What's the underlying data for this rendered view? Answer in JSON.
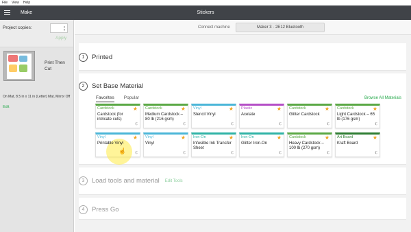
{
  "os_menu": [
    "File",
    "View",
    "Help"
  ],
  "header": {
    "make": "Make",
    "title": "Stickers"
  },
  "left": {
    "copies_label": "Project copies:",
    "copies_value": "",
    "apply_label": "Apply",
    "mat_type": "Print Then Cut",
    "mat_desc": "On Mat, 8.5 in x 11 in (Letter) Mat, Mirror Off",
    "edit_label": "Edit"
  },
  "connect": {
    "label": "Connect machine",
    "machine": "Maker 3 · 2E12 Bluetooth"
  },
  "steps": [
    {
      "num": "1",
      "title": "Printed"
    },
    {
      "num": "2",
      "title": "Set Base Material"
    },
    {
      "num": "3",
      "title": "Load tools and material",
      "extra": "Edit Tools"
    },
    {
      "num": "4",
      "title": "Press Go"
    }
  ],
  "tabs": [
    "Favorites",
    "Popular"
  ],
  "browse_label": "Browse All Materials",
  "colors": {
    "cardstock": "#5aa844",
    "vinyl": "#4ab6d8",
    "plastic": "#b54ec6",
    "ironon": "#2fb3a6",
    "artboard": "#2e7d32",
    "accent": "#25a94b",
    "star": "#f0a31e"
  },
  "materials": [
    {
      "category": "Cardstock",
      "name": "Cardstock (for intricate cuts)",
      "color": "#5aa844"
    },
    {
      "category": "Cardstock",
      "name": "Medium Cardstock – 80 lb (216 gsm)",
      "color": "#5aa844"
    },
    {
      "category": "Vinyl",
      "name": "Stencil Vinyl",
      "color": "#4ab6d8"
    },
    {
      "category": "Plastic",
      "name": "Acetate",
      "color": "#b54ec6"
    },
    {
      "category": "Cardstock",
      "name": "Glitter Cardstock",
      "color": "#5aa844"
    },
    {
      "category": "Cardstock",
      "name": "Light Cardstock – 65 lb (176 gsm)",
      "color": "#5aa844"
    },
    {
      "category": "Vinyl",
      "name": "Printable Vinyl",
      "color": "#4ab6d8"
    },
    {
      "category": "Vinyl",
      "name": "Vinyl",
      "color": "#4ab6d8"
    },
    {
      "category": "Iron-On",
      "name": "Infusible Ink Transfer Sheet",
      "color": "#2fb3a6"
    },
    {
      "category": "Iron-On",
      "name": "Glitter Iron-On",
      "color": "#2fb3a6"
    },
    {
      "category": "Cardstock",
      "name": "Heavy Cardstock – 100 lb (270 gsm)",
      "color": "#5aa844"
    },
    {
      "category": "Art Board",
      "name": "Kraft Board",
      "color": "#2e7d32"
    }
  ],
  "card_icons": {
    "star": "star-icon",
    "cut": "cut-setting-icon"
  }
}
